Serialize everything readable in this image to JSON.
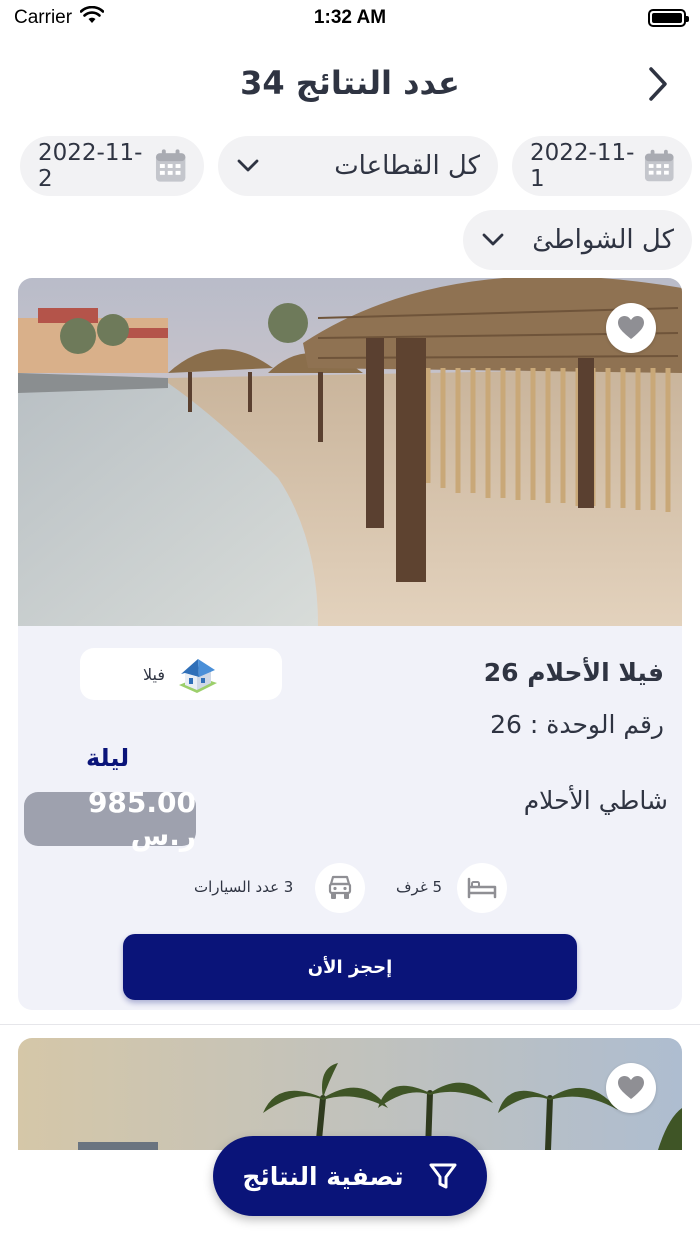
{
  "status_bar": {
    "carrier": "Carrier",
    "time": "1:32 AM"
  },
  "header": {
    "title": "عدد النتائج  34"
  },
  "filters": {
    "date_from": "2022-11-1",
    "date_to": "2022-11-2",
    "sector_select": "كل القطاعات",
    "beach_select": "كل الشواطئ"
  },
  "listings": [
    {
      "name": "فيلا الأحلام 26",
      "unit_number": "رقم الوحدة : 26",
      "beach": "شاطي الأحلام",
      "type_label": "فيلا",
      "price_unit": "ليلة",
      "price": "985.00 ر.س",
      "rooms": "5  غرف",
      "cars": "3  عدد السيارات",
      "book_label": "إحجز الأن",
      "favorite": false
    }
  ],
  "filter_button": {
    "label": "تصفية النتائج"
  },
  "colors": {
    "primary": "#0a1479",
    "text": "#2f3442",
    "pill_bg": "#f2f2f4",
    "card_bg": "#f1f2f9",
    "price_bg": "#9ea1ae"
  }
}
